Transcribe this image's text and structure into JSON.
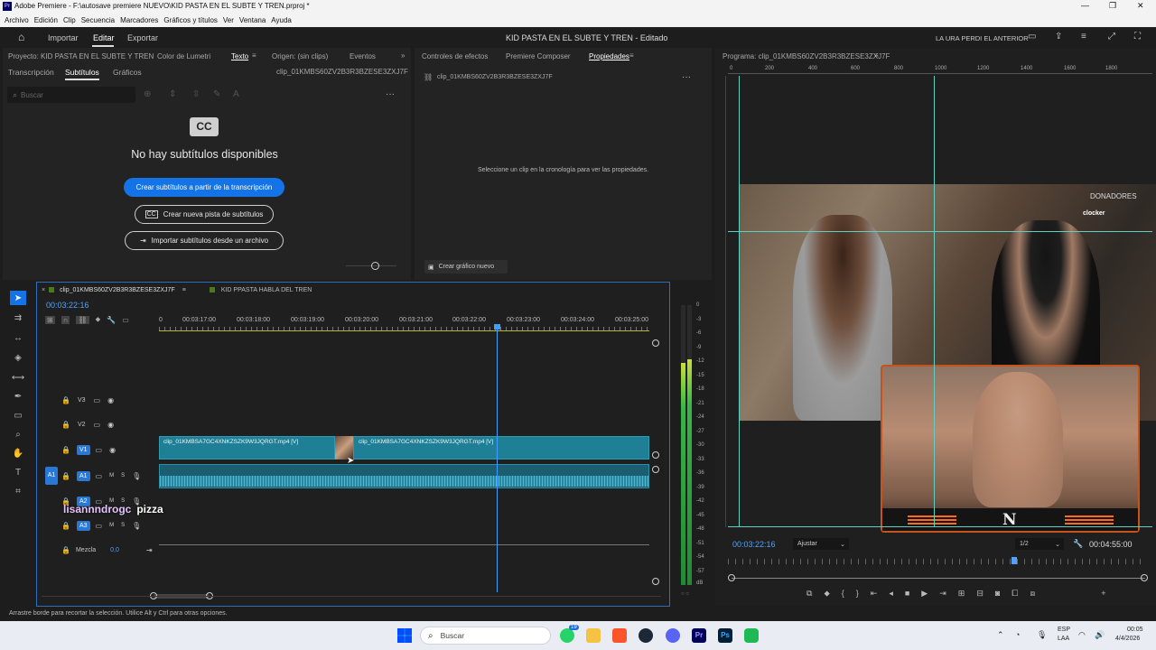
{
  "window": {
    "title": "Adobe Premiere - F:\\autosave premiere NUEVO\\KID PASTA EN EL SUBTE Y TREN.prproj *",
    "controls": [
      "—",
      "❐",
      "✕"
    ]
  },
  "menu": [
    "Archivo",
    "Edición",
    "Clip",
    "Secuencia",
    "Marcadores",
    "Gráficos y títulos",
    "Ver",
    "Ventana",
    "Ayuda"
  ],
  "appbar": {
    "tabs": [
      "Importar",
      "Editar",
      "Exportar"
    ],
    "active_tab": "Editar",
    "project_title": "KID PASTA EN EL SUBTE Y TREN",
    "project_status": "Editado",
    "right_label": "LA URA PERDI EL ANTERIOR"
  },
  "left_panel": {
    "tabs": [
      "Proyecto: KID PASTA EN EL SUBTE Y TREN",
      "Color de Lumetri",
      "Texto",
      "Origen: (sin clips)",
      "Eventos"
    ],
    "active_tab": "Texto",
    "subtabs": [
      "Transcripción",
      "Subtítulos",
      "Gráficos"
    ],
    "active_subtab": "Subtítulos",
    "clip_name": "clip_01KMBS60ZV2B3R3BZESE3ZXJ7F",
    "search_placeholder": "Buscar",
    "cc_badge": "CC",
    "empty_message": "No hay subtítulos disponibles",
    "btn_create_from_transcript": "Crear subtítulos a partir de la transcripción",
    "btn_new_track": "Crear nueva pista de subtítulos",
    "btn_import": "Importar subtítulos desde un archivo"
  },
  "middle_panel": {
    "tabs": [
      "Controles de efectos",
      "Premiere Composer",
      "Propiedades"
    ],
    "active_tab": "Propiedades",
    "clip_name": "clip_01KMBS60ZV2B3R3BZESE3ZXJ7F",
    "hint": "Seleccione un clip en la cronología para ver las propiedades.",
    "btn_new_graphic": "Crear gráfico nuevo"
  },
  "program_monitor": {
    "title": "Programa: clip_01KMBS60ZV2B3R3BZESE3ZXJ7F",
    "ruler_labels": [
      "0",
      "200",
      "400",
      "600",
      "800",
      "1000",
      "1200",
      "1400",
      "1600",
      "1800"
    ],
    "timecode": "00:03:22:16",
    "fit": "Ajustar",
    "resolution": "1/2",
    "duration": "00:04:55:00",
    "overlay_donadores": "DONADORES",
    "overlay_clocker": "clocker",
    "overlay_logo": "N"
  },
  "timeline": {
    "tabs": [
      "clip_01KMBS60ZV2B3R3BZESE3ZXJ7F",
      "KID PPASTA HABLA DEL TREN"
    ],
    "timecode": "00:03:22:16",
    "ruler": [
      "0",
      "00:03:17:00",
      "00:03:18:00",
      "00:03:19:00",
      "00:03:20:00",
      "00:03:21:00",
      "00:03:22:00",
      "00:03:23:00",
      "00:03:24:00",
      "00:03:25:00"
    ],
    "video_tracks": [
      "V3",
      "V2",
      "V1"
    ],
    "audio_tracks": [
      "A1",
      "A2",
      "A3"
    ],
    "mix_label": "Mezcla",
    "mix_value": "0,0",
    "clip_a": "clip_01KMBSA7GC4XNKZSZK9W3JQRGT.mp4 [V]",
    "clip_b": "clip_01KMBSA7GC4XNKZSZK9W3JQRGT.mp4 [V]",
    "overlay_user": "lisannndrogc",
    "overlay_text": "pizza",
    "track_btn_m": "M",
    "track_btn_s": "S"
  },
  "meter": {
    "labels": [
      "0",
      "-3",
      "-6",
      "-9",
      "-12",
      "-15",
      "-18",
      "-21",
      "-24",
      "-27",
      "-30",
      "-33",
      "-36",
      "-39",
      "-42",
      "-45",
      "-48",
      "-51",
      "-54",
      "-57",
      "dB"
    ],
    "level_db": -9
  },
  "status_bar": "Arrastre borde para recortar la selección. Utilice Alt y Ctrl para otras opciones.",
  "taskbar": {
    "search_placeholder": "Buscar",
    "lang": "ESP",
    "lang2": "LAA",
    "time": "00:05",
    "date": "4/4/2026",
    "badge": "19"
  },
  "colors": {
    "accent_blue": "#1473e6",
    "clip_teal": "#1f7f96",
    "audio_teal": "#2a8fa8",
    "playhead": "#3da0ff",
    "track_label_blue": "#2a78d6",
    "timecode_blue": "#4ea3ff"
  }
}
